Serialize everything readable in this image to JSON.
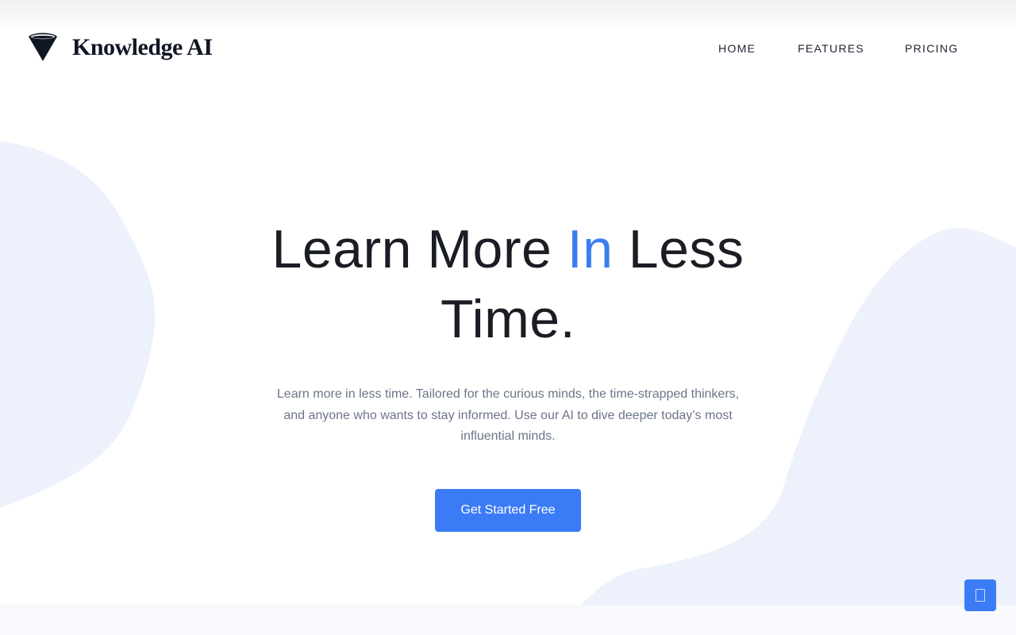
{
  "brand": {
    "name": "Knowledge AI",
    "logo_icon": "cone-logo-icon"
  },
  "nav": {
    "items": [
      {
        "label": "HOME"
      },
      {
        "label": "FEATURES"
      },
      {
        "label": "PRICING"
      }
    ]
  },
  "hero": {
    "title_part1": "Learn More ",
    "title_accent": "In",
    "title_part2": " Less Time.",
    "subtitle": "Learn more in less time. Tailored for the curious minds, the time-strapped thinkers, and anyone who wants to stay informed. Use our AI to dive deeper today’s most influential minds.",
    "cta_label": "Get Started Free"
  },
  "scroll_top": {
    "icon": "scroll-to-top-icon"
  },
  "colors": {
    "accent": "#3b7cf6",
    "blob": "#edf1fb",
    "heading": "#1a1d24",
    "body_text": "#6b7588"
  }
}
